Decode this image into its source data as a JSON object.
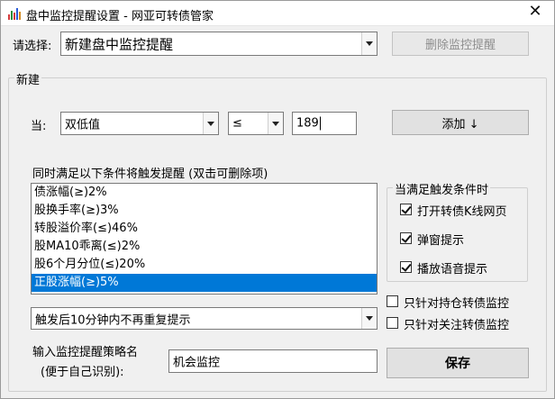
{
  "window": {
    "title": "盘中监控提醒设置 - 网亚可转债管家",
    "close_symbol": "✕"
  },
  "top": {
    "select_label": "请选择:",
    "selected_value": "新建盘中监控提醒",
    "delete_button": "删除监控提醒"
  },
  "new_group": {
    "legend": "新建",
    "when_label": "当:",
    "field_value": "双低值",
    "operator_value": "≤",
    "threshold_value": "189",
    "add_button": "添加 ↓"
  },
  "conditions": {
    "heading": "同时满足以下条件将触发提醒 (双击可删除项)",
    "items": [
      "债涨幅(≥)2%",
      "股换手率(≥)3%",
      "转股溢价率(≤)46%",
      "股MA10乖离(≤)2%",
      "股6个月分位(≤)20%",
      "正股涨幅(≥)5%"
    ],
    "selected_index": 5
  },
  "trigger_group": {
    "legend": "当满足触发条件时",
    "options": [
      {
        "label": "打开转债K线网页",
        "checked": true
      },
      {
        "label": "弹窗提示",
        "checked": true
      },
      {
        "label": "播放语音提示",
        "checked": true
      }
    ]
  },
  "filters": [
    {
      "label": "只针对持仓转债监控",
      "checked": false
    },
    {
      "label": "只针对关注转债监控",
      "checked": false
    }
  ],
  "repeat": {
    "value": "触发后10分钟内不再重复提示"
  },
  "strategy": {
    "label_line1": "输入监控提醒策略名",
    "label_line2": "(便于自己识别):",
    "name_value": "机会监控",
    "save_button": "保存"
  }
}
